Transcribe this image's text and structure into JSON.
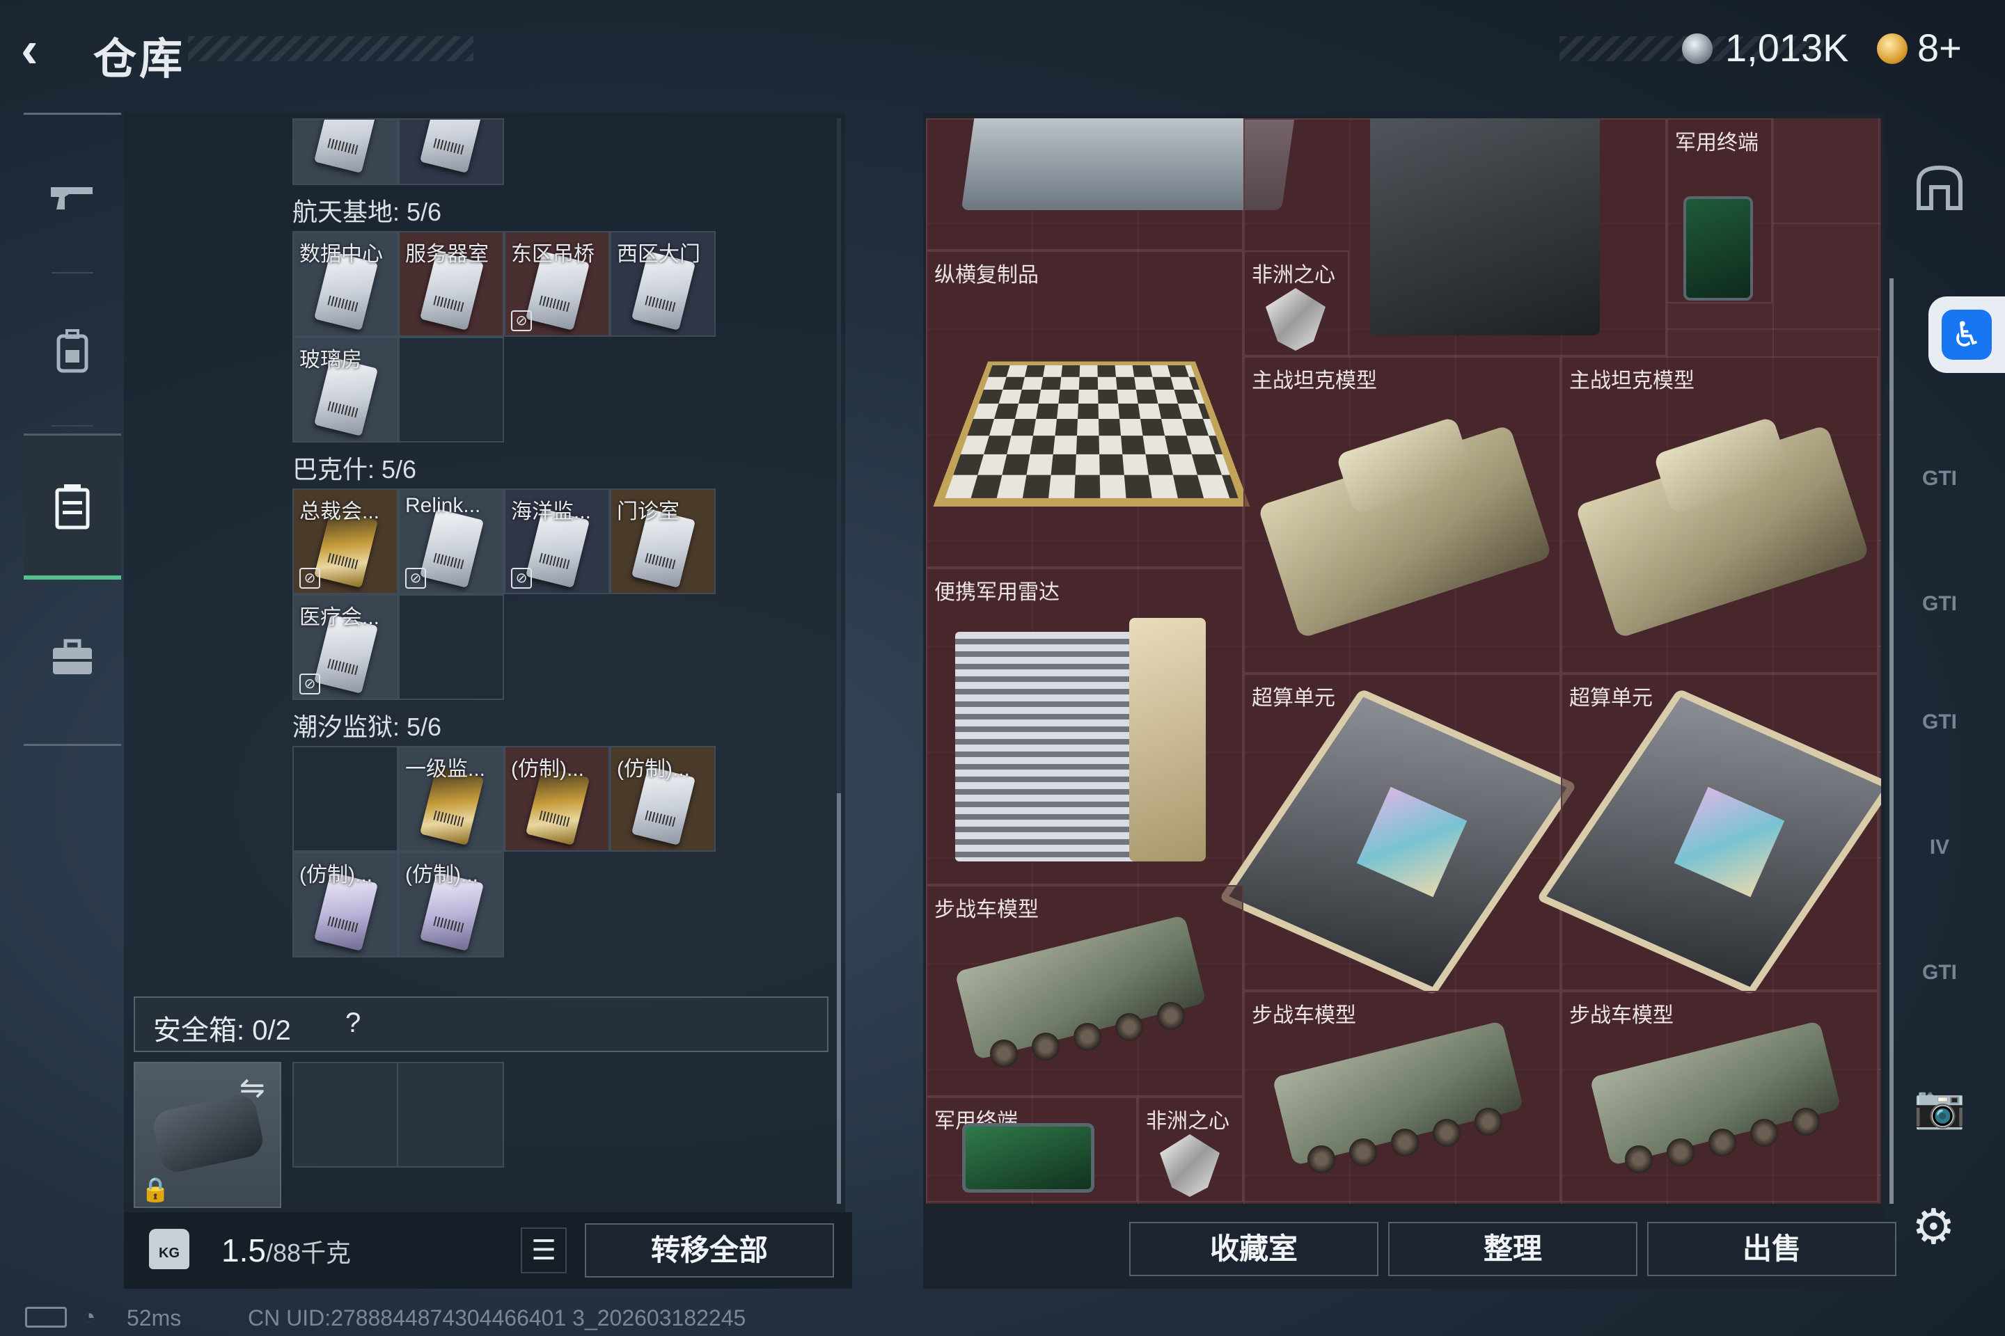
{
  "header": {
    "back_icon": "‹",
    "title": "仓库",
    "currency1": "1,013K",
    "currency2": "8+"
  },
  "left_nav": [
    "weapon-icon",
    "backpack-icon",
    "container-icon",
    "briefcase-icon"
  ],
  "stash": {
    "groups": [
      {
        "name": "航天基地: 5/6"
      },
      {
        "name": "巴克什: 5/6"
      },
      {
        "name": "潮汐监狱: 5/6"
      }
    ],
    "cells": {
      "g1": [
        "数据中心",
        "服务器室",
        "东区吊桥",
        "西区大门",
        "玻璃房"
      ],
      "g2": [
        "总裁会...",
        "Relink...",
        "海洋监...",
        "门诊室",
        "医疗会..."
      ],
      "g3": [
        "一级监...",
        "(仿制)...",
        "(仿制)...",
        "(仿制)...",
        "(仿制)..."
      ]
    }
  },
  "safe_box": {
    "label": "安全箱: 0/2",
    "help": "?"
  },
  "bottom_left": {
    "weight": "1.5",
    "capacity": "/88千克",
    "kg_label": "KG",
    "transfer_all": "转移全部"
  },
  "grid_items": [
    {
      "label": "军用终端"
    },
    {
      "label": "纵横复制品"
    },
    {
      "label": "非洲之心"
    },
    {
      "label": "主战坦克模型"
    },
    {
      "label": "主战坦克模型"
    },
    {
      "label": "便携军用雷达"
    },
    {
      "label": "超算单元"
    },
    {
      "label": "超算单元"
    },
    {
      "label": "步战车模型"
    },
    {
      "label": "步战车模型"
    },
    {
      "label": "步战车模型"
    },
    {
      "label": "军用终端"
    },
    {
      "label": "非洲之心"
    }
  ],
  "bottom_right": {
    "collection": "收藏室",
    "sort": "整理",
    "sell": "出售"
  },
  "right_nav": [
    "armor-icon",
    "gt-vest-icon",
    "gt-plate-icon",
    "gt-rig-icon",
    "iv-rig-icon",
    "gt-chest-icon",
    "iv-scope-icon"
  ],
  "right_nav_text": [
    "",
    "GTI",
    "GTI",
    "GTI",
    "IV",
    "GTI",
    ""
  ],
  "status": {
    "ping": "52ms",
    "uid": "CN UID:2788844874304466401 3_202603182245"
  }
}
